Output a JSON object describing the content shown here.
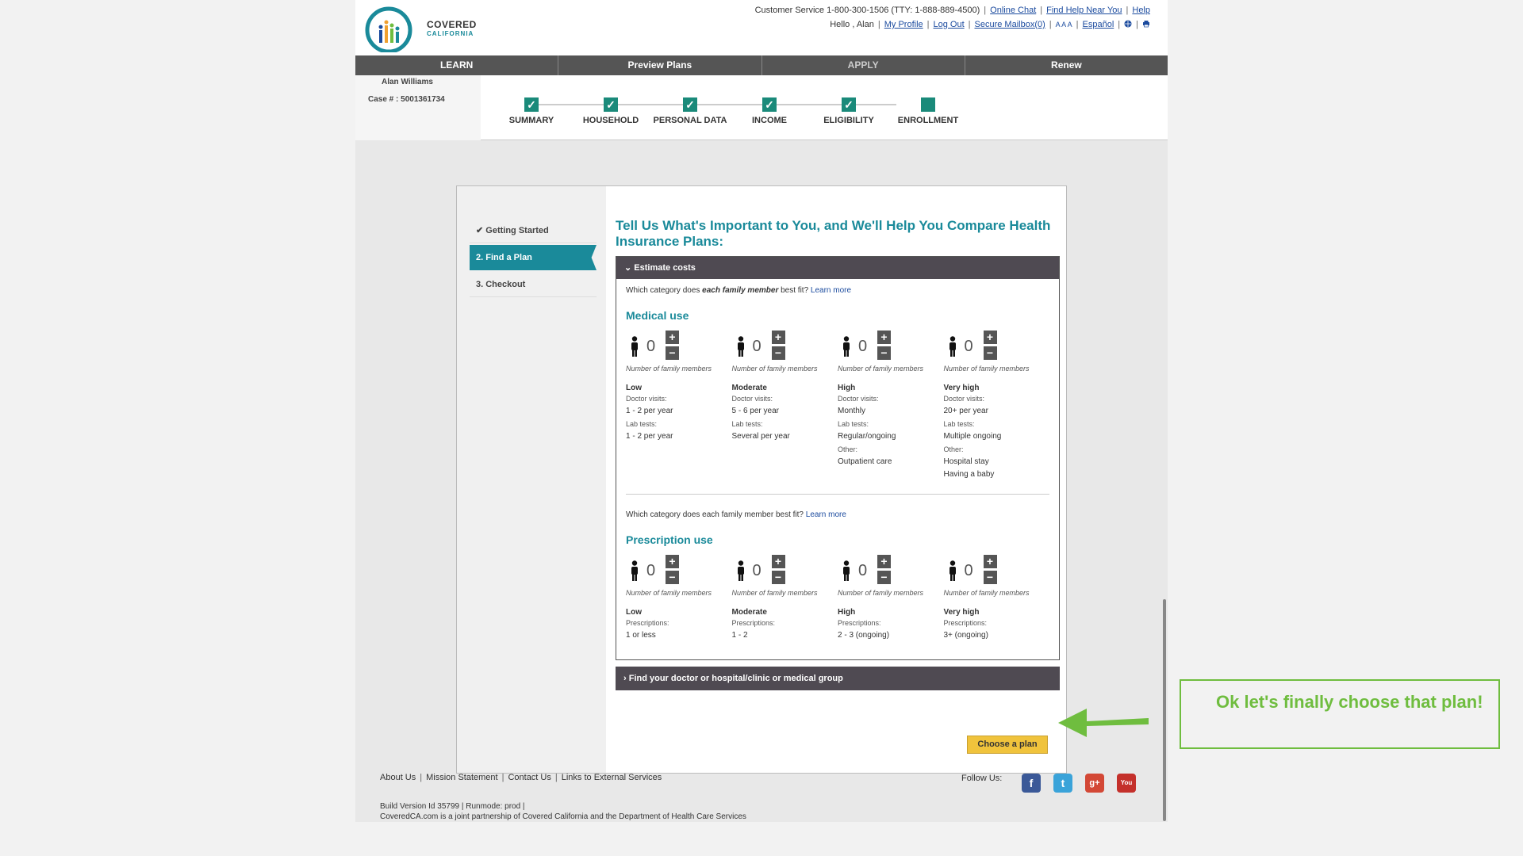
{
  "header": {
    "logo": {
      "name": "COVERED",
      "sub": "CALIFORNIA"
    },
    "customer_service": "Customer Service 1-800-300-1506 (TTY: 1-888-889-4500)",
    "online_chat": "Online Chat",
    "find_help": "Find Help Near You",
    "help": "Help",
    "hello": "Hello , Alan",
    "my_profile": "My Profile",
    "log_out": "Log Out",
    "secure_mailbox": "Secure Mailbox(0)",
    "text_size": "A A A",
    "espanol": "Español"
  },
  "nav": {
    "learn": "LEARN",
    "preview": "Preview Plans",
    "apply": "APPLY",
    "renew": "Renew"
  },
  "user": {
    "name": "Alan Williams",
    "case": "Case # : 5001361734"
  },
  "steps": [
    "SUMMARY",
    "HOUSEHOLD",
    "PERSONAL DATA",
    "INCOME",
    "ELIGIBILITY",
    "ENROLLMENT"
  ],
  "sidebar": {
    "items": [
      "Getting Started",
      "2.  Find a Plan",
      "3.  Checkout"
    ]
  },
  "card": {
    "title": "Tell Us What's Important to You, and We'll Help You Compare Health Insurance Plans:",
    "acc1_label": "Estimate costs",
    "q1_pre": "Which category does ",
    "q1_em": "each family member",
    "q1_post": " best fit? ",
    "learn_more": "Learn more",
    "medical_title": "Medical use",
    "q2": "Which category does each family member best fit? ",
    "rx_title": "Prescription use",
    "nfm": "Number of family members",
    "acc2_label": "Find your doctor or hospital/clinic or medical group",
    "choose": "Choose a plan"
  },
  "medical": [
    {
      "count": "0",
      "name": "Low",
      "rows": [
        [
          "Doctor visits:",
          "1 - 2 per year"
        ],
        [
          "Lab tests:",
          "1 - 2 per year"
        ]
      ]
    },
    {
      "count": "0",
      "name": "Moderate",
      "rows": [
        [
          "Doctor visits:",
          "5 - 6 per year"
        ],
        [
          "Lab tests:",
          "Several per year"
        ]
      ]
    },
    {
      "count": "0",
      "name": "High",
      "rows": [
        [
          "Doctor visits:",
          "Monthly"
        ],
        [
          "Lab tests:",
          "Regular/ongoing"
        ],
        [
          "Other:",
          "Outpatient care"
        ]
      ]
    },
    {
      "count": "0",
      "name": "Very high",
      "rows": [
        [
          "Doctor visits:",
          "20+ per year"
        ],
        [
          "Lab tests:",
          "Multiple ongoing"
        ],
        [
          "Other:",
          "Hospital stay\nHaving a baby"
        ]
      ]
    }
  ],
  "rx": [
    {
      "count": "0",
      "name": "Low",
      "rows": [
        [
          "Prescriptions:",
          "1 or less"
        ]
      ]
    },
    {
      "count": "0",
      "name": "Moderate",
      "rows": [
        [
          "Prescriptions:",
          "1 - 2"
        ]
      ]
    },
    {
      "count": "0",
      "name": "High",
      "rows": [
        [
          "Prescriptions:",
          "2 - 3 (ongoing)"
        ]
      ]
    },
    {
      "count": "0",
      "name": "Very high",
      "rows": [
        [
          "Prescriptions:",
          "3+ (ongoing)"
        ]
      ]
    }
  ],
  "footer": {
    "about": "About Us",
    "mission": "Mission Statement",
    "contact": "Contact Us",
    "external": "Links to External Services",
    "follow": "Follow Us:",
    "build": "Build Version Id 35799  |    Runmode: prod  |",
    "partner": "CoveredCA.com is a joint partnership of Covered California and the Department of Health Care Services"
  },
  "annotation": {
    "note": "Ok let's finally choose that plan!"
  },
  "colors": {
    "teal": "#1a8a9a",
    "nav": "#555555",
    "accent_green": "#6fbd3f",
    "button": "#f0c33c"
  }
}
